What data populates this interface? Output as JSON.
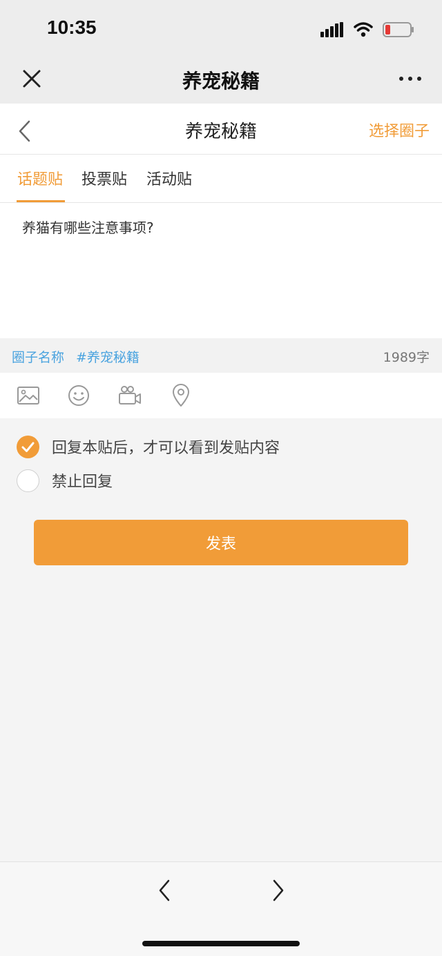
{
  "status_bar": {
    "time": "10:35"
  },
  "nav": {
    "title": "养宠秘籍"
  },
  "header": {
    "title": "养宠秘籍",
    "select_circle": "选择圈子"
  },
  "tabs": [
    {
      "label": "话题贴",
      "active": true
    },
    {
      "label": "投票贴",
      "active": false
    },
    {
      "label": "活动贴",
      "active": false
    }
  ],
  "content": {
    "text": "养猫有哪些注意事项?"
  },
  "tags": {
    "circle_name": "圈子名称",
    "topic": "#养宠秘籍",
    "count": "1989字"
  },
  "toolbar": {
    "icons": [
      "image-icon",
      "emoji-icon",
      "video-icon",
      "location-icon"
    ]
  },
  "options": [
    {
      "label": "回复本贴后，才可以看到发贴内容",
      "checked": true
    },
    {
      "label": "禁止回复",
      "checked": false
    }
  ],
  "submit": {
    "label": "发表"
  },
  "colors": {
    "accent": "#f19c38",
    "link": "#4aa3df"
  }
}
